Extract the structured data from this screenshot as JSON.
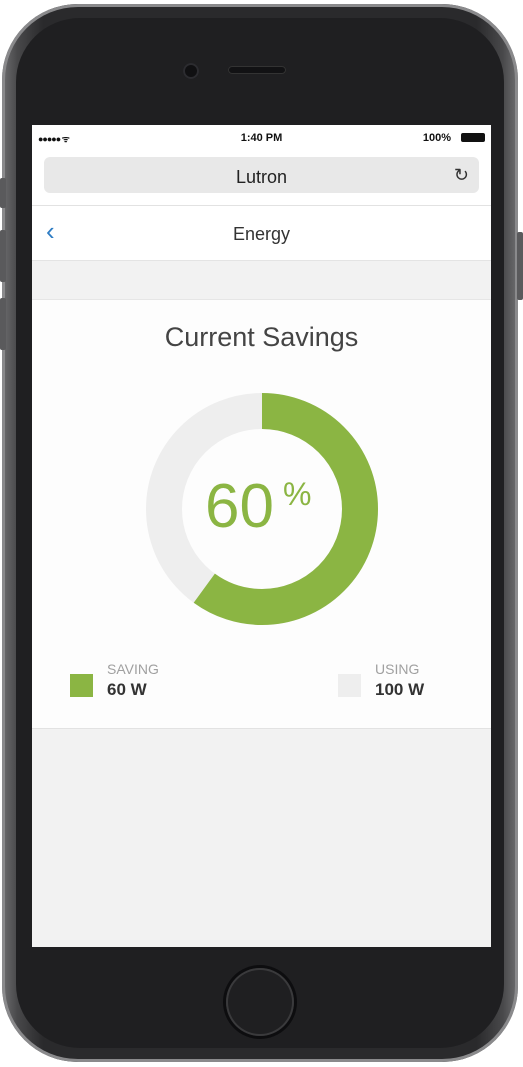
{
  "status_bar": {
    "signal": "●●●●● ᯤ",
    "time": "1:40 PM",
    "battery": "100%"
  },
  "browser": {
    "url_title": "Lutron",
    "reload_icon": "↻"
  },
  "nav": {
    "back_icon": "‹",
    "title": "Energy"
  },
  "savings": {
    "title": "Current Savings",
    "percent_value": "60",
    "percent_sign": "%",
    "fraction": 0.6,
    "saving_label": "SAVING",
    "saving_value": "60 W",
    "using_label": "USING",
    "using_value": "100 W"
  },
  "colors": {
    "accent": "#8bb543",
    "track": "#eeeeee",
    "back": "#2f7dc4"
  }
}
